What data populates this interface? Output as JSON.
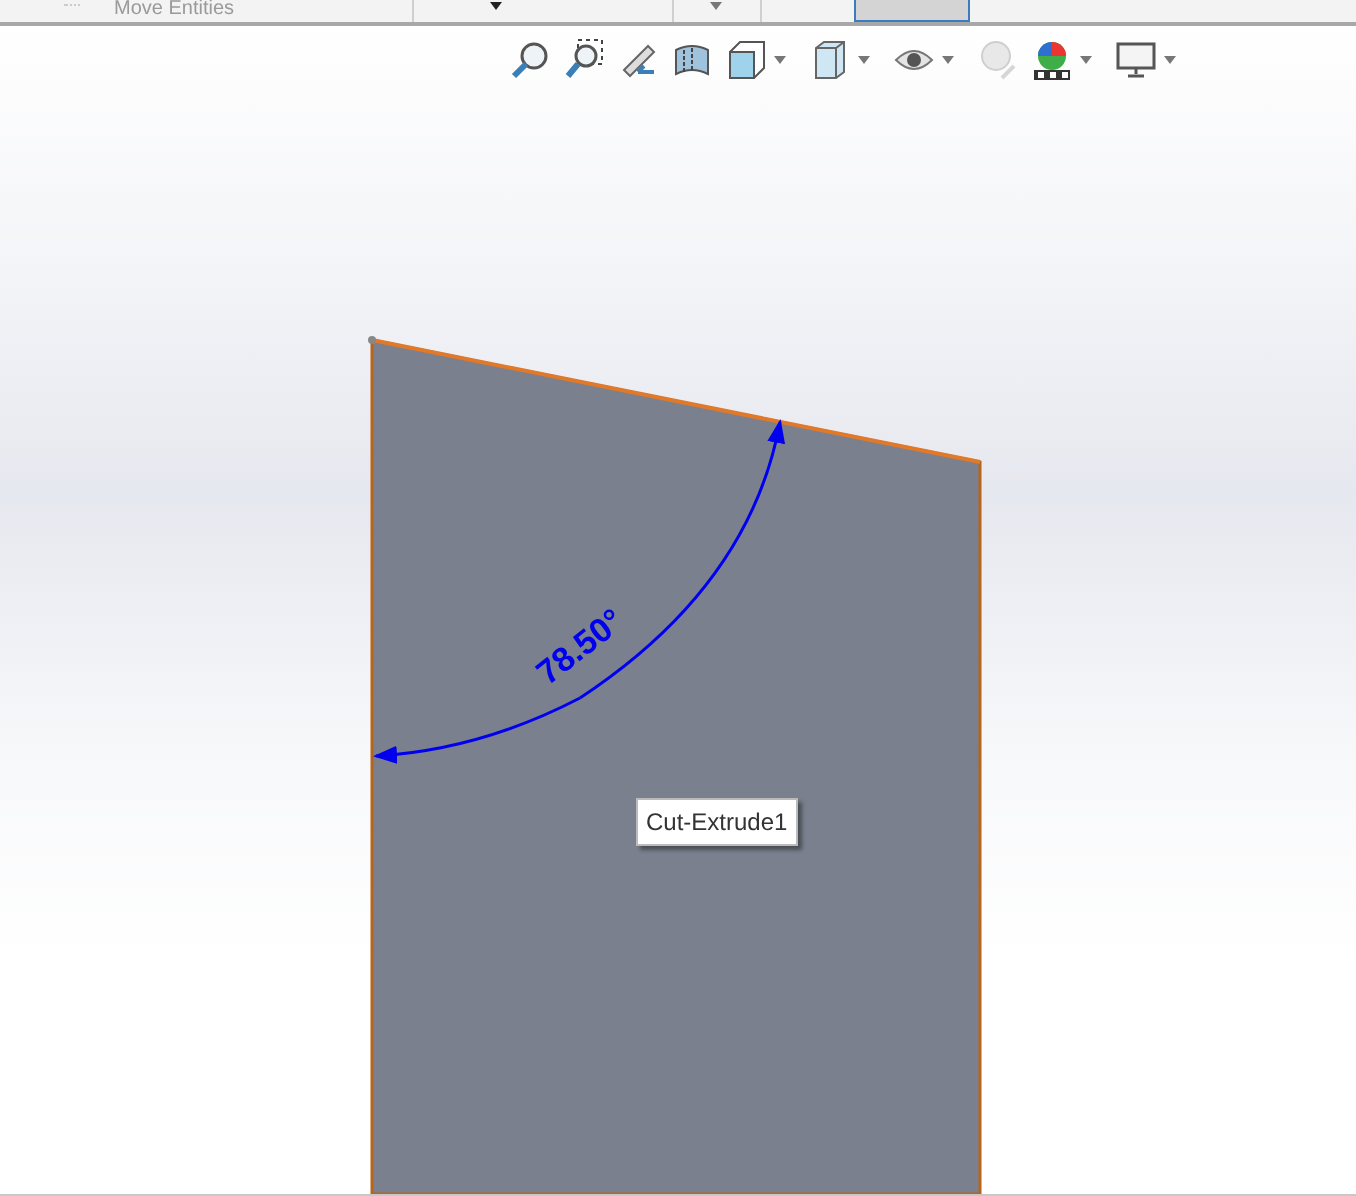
{
  "command_bar": {
    "command": "Move Entities"
  },
  "dimension": {
    "value": "78.50°"
  },
  "tooltip": {
    "text": "Cut-Extrude1"
  }
}
